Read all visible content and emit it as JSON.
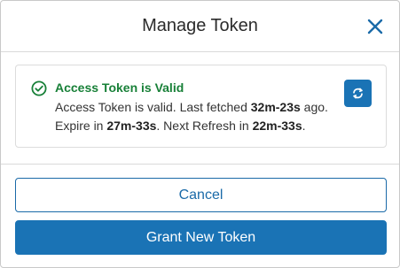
{
  "dialog": {
    "title": "Manage Token"
  },
  "alert": {
    "title": "Access Token is Valid",
    "line1_prefix": "Access Token is valid. Last fetched ",
    "last_fetched": "32m-23s",
    "line1_suffix": " ago.",
    "line2_prefix": "Expire in ",
    "expire_in": "27m-33s",
    "line2_mid": ". Next Refresh in ",
    "next_refresh": "22m-33s",
    "line2_suffix": ".",
    "icon": "check-circle-icon",
    "refresh_icon": "refresh-icon"
  },
  "buttons": {
    "cancel": "Cancel",
    "grant": "Grant New Token"
  },
  "colors": {
    "accent": "#1a73b5",
    "success": "#188038"
  }
}
